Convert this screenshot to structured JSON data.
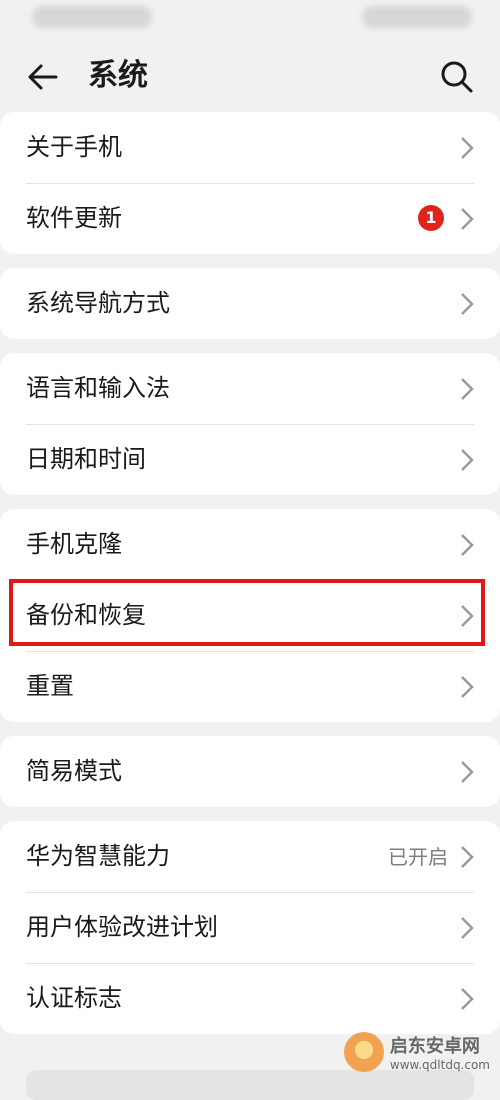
{
  "header": {
    "title": "系统"
  },
  "groups": [
    {
      "items": [
        {
          "label": "关于手机"
        },
        {
          "label": "软件更新",
          "badge": "1"
        }
      ]
    },
    {
      "items": [
        {
          "label": "系统导航方式"
        }
      ]
    },
    {
      "items": [
        {
          "label": "语言和输入法"
        },
        {
          "label": "日期和时间"
        }
      ]
    },
    {
      "items": [
        {
          "label": "手机克隆"
        },
        {
          "label": "备份和恢复"
        },
        {
          "label": "重置"
        }
      ]
    },
    {
      "items": [
        {
          "label": "简易模式"
        }
      ]
    },
    {
      "items": [
        {
          "label": "华为智慧能力",
          "status": "已开启"
        },
        {
          "label": "用户体验改进计划"
        },
        {
          "label": "认证标志"
        }
      ]
    }
  ],
  "watermark": {
    "name": "启东安卓网",
    "url": "www.qdltdq.com"
  },
  "colors": {
    "badge": "#e0241c",
    "highlight": "#e01818",
    "background": "#f1f1f1"
  }
}
